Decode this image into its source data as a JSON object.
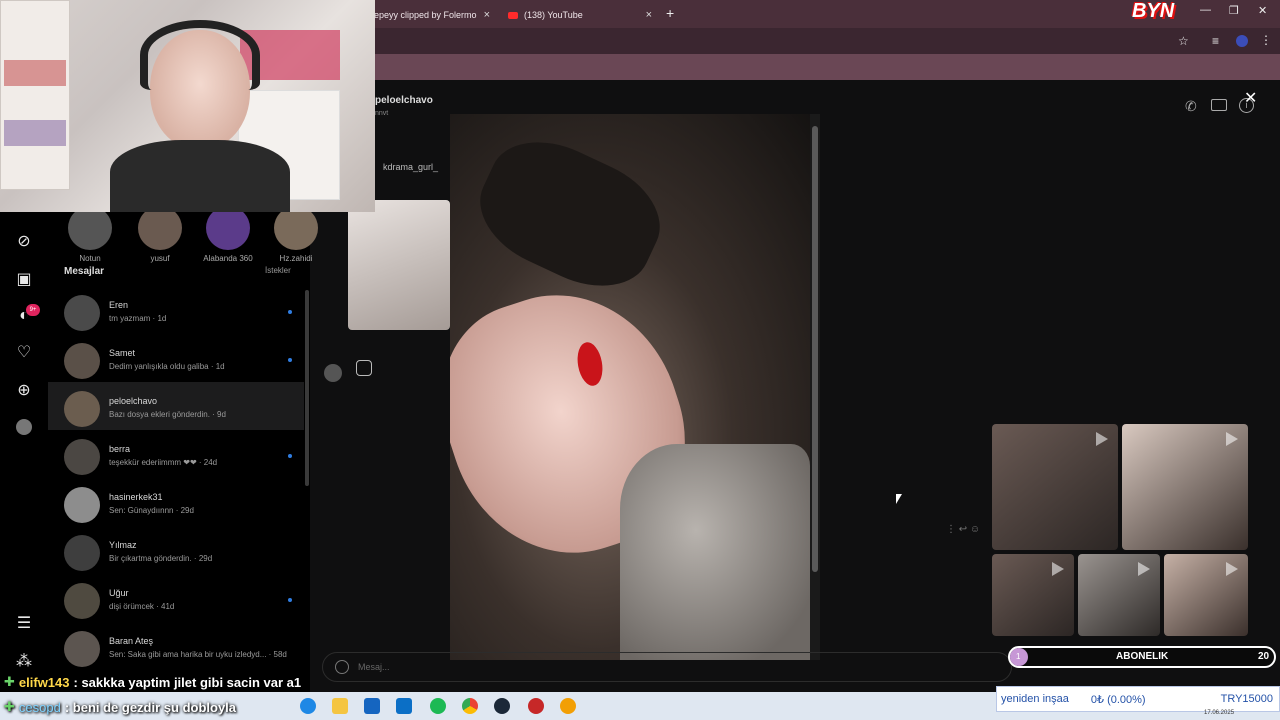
{
  "browser": {
    "tabs": [
      {
        "label": "epeyy clipped by Folermo"
      },
      {
        "label": "(138) YouTube"
      }
    ],
    "new_tab": "+",
    "close": "×",
    "window_controls": {
      "minimize": "—",
      "maximize": "❐",
      "close": "✕"
    }
  },
  "watermark": "BYN",
  "conversation": {
    "contact": "peloelchavo",
    "contact_sub": "nnvt",
    "reply_user": "kdrama_gurl_",
    "message_placeholder": "Mesaj...",
    "close_label": "✕"
  },
  "stories": [
    {
      "label": "Notun"
    },
    {
      "label": "yusuf"
    },
    {
      "label": "Alabanda 360"
    },
    {
      "label": "Hz.zahidi"
    }
  ],
  "messages_header": {
    "title": "Mesajlar",
    "requests": "İstekler"
  },
  "nav_badge": "9+",
  "dm_list": [
    {
      "name": "Eren",
      "msg": "tm yazmam · 1d",
      "unread": true
    },
    {
      "name": "Samet",
      "msg": "Dedim yanlışıkla oldu galiba · 1d",
      "unread": true
    },
    {
      "name": "peloelchavo",
      "msg": "Bazı dosya ekleri gönderdin. · 9d",
      "unread": false
    },
    {
      "name": "berra",
      "msg": "teşekkür ederiimmm ❤❤ · 24d",
      "unread": true
    },
    {
      "name": "hasinerkek31",
      "msg": "Sen: Günaydıınnn · 29d",
      "unread": false
    },
    {
      "name": "Yılmaz",
      "msg": "Bir çıkartma gönderdin. · 29d",
      "unread": false
    },
    {
      "name": "Uğur",
      "msg": "dişi örümcek · 41d",
      "unread": true
    },
    {
      "name": "Baran Ateş",
      "msg": "Sen: Saka gibi ama harika bir uyku izledyd... · 58d",
      "unread": false
    }
  ],
  "chat": [
    {
      "user": "elifw143",
      "text": ": sakkka yaptim jilet gibi sacin var a1"
    },
    {
      "user": "cesopd",
      "text": ": beni de gezdir şu dobloyla"
    }
  ],
  "subscription": {
    "label": "ABONELIK",
    "current": "1",
    "goal": "20",
    "progress": 0.05
  },
  "ticker": {
    "label": "yeniden inşaa",
    "amount": "0₺ (0.00%)",
    "goal": "TRY15000"
  },
  "taskbar": {
    "date": "17.06.2025"
  },
  "colors": {
    "tabbar": "#4a2f3a",
    "accent_unread": "#2f7de1",
    "chat_user": "#ffd84a"
  }
}
